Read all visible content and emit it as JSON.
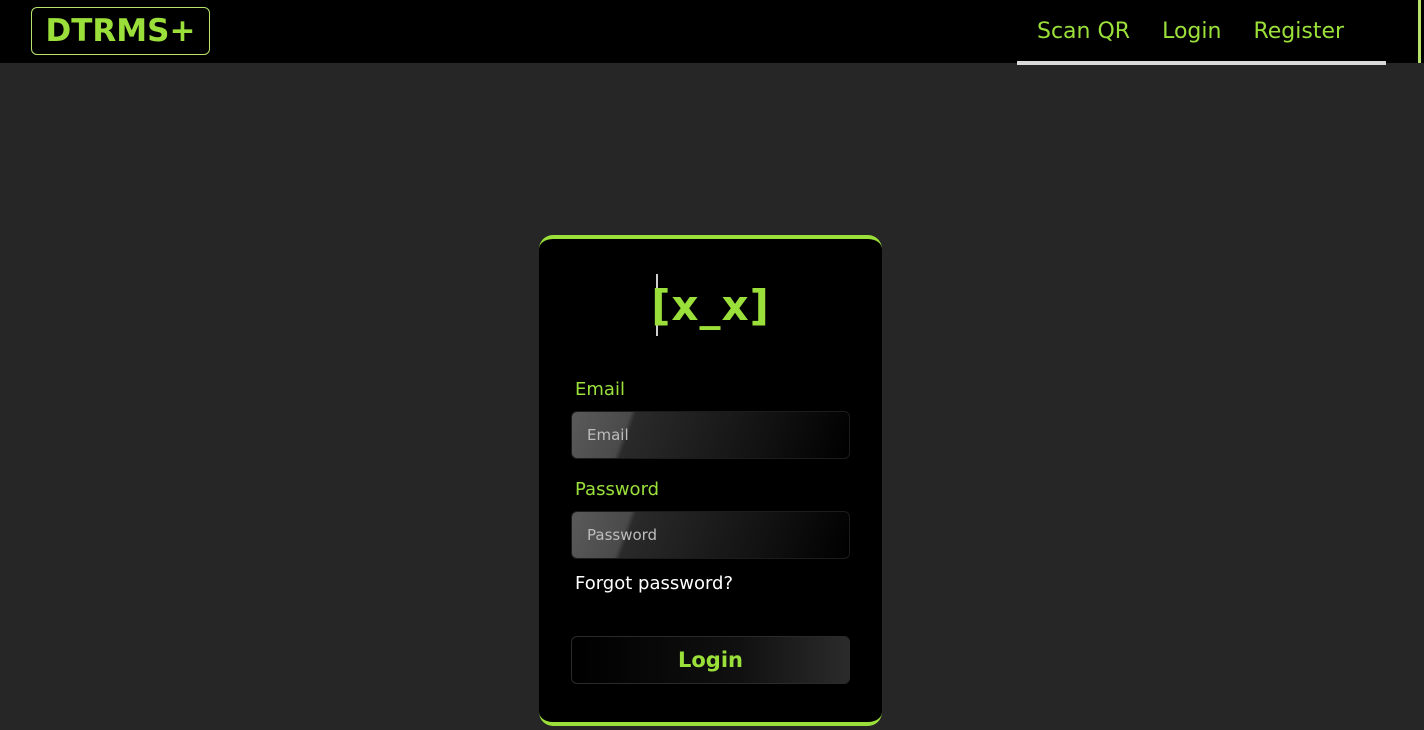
{
  "brand": {
    "name": "DTRMS+"
  },
  "nav": {
    "links": [
      {
        "label": "Scan QR"
      },
      {
        "label": "Login"
      },
      {
        "label": "Register"
      }
    ]
  },
  "login_card": {
    "logo_text": "[x_x]",
    "email": {
      "label": "Email",
      "placeholder": "Email",
      "value": ""
    },
    "password": {
      "label": "Password",
      "placeholder": "Password",
      "value": ""
    },
    "forgot_label": "Forgot password?",
    "submit_label": "Login"
  },
  "colors": {
    "accent": "#9be03a",
    "background": "#262626",
    "navbar": "#000000",
    "card": "#000000"
  }
}
